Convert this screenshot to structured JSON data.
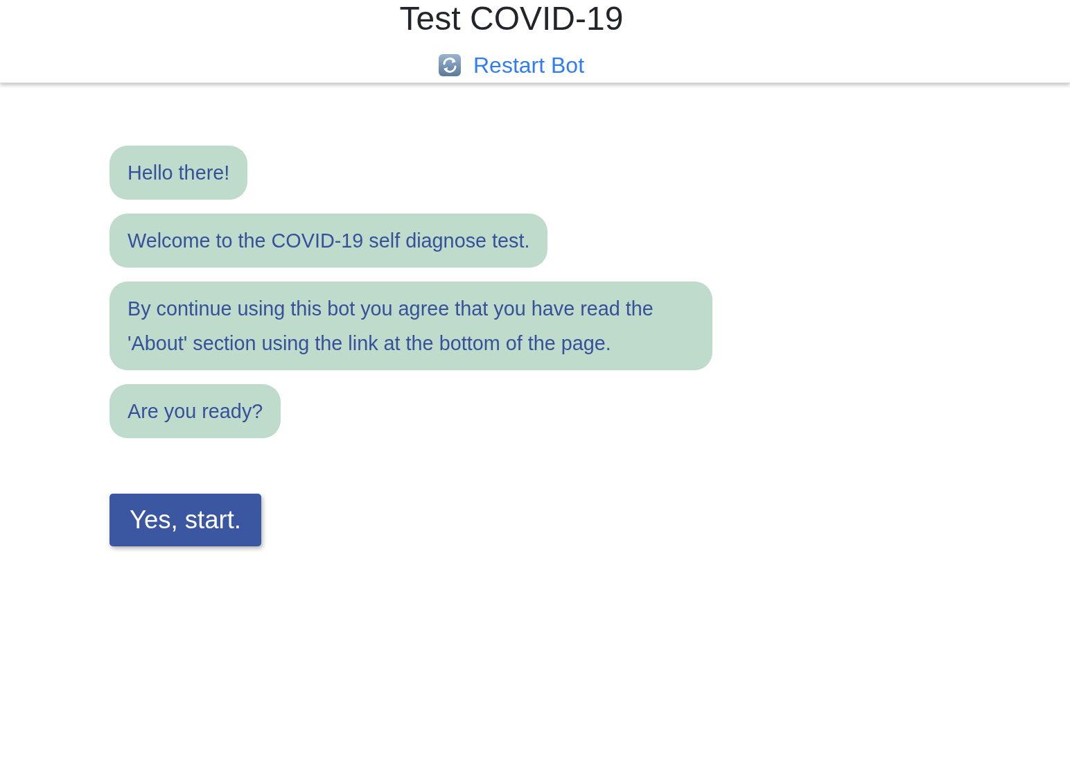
{
  "header": {
    "title": "Test COVID-19",
    "restart_link": "Restart Bot"
  },
  "messages": [
    "Hello there!",
    "Welcome to the COVID-19 self diagnose test.",
    "By continue using this bot you agree that you have read the 'About' section using the link at the bottom of the page.",
    "Are you ready?"
  ],
  "reply_buttons": [
    "Yes, start."
  ]
}
